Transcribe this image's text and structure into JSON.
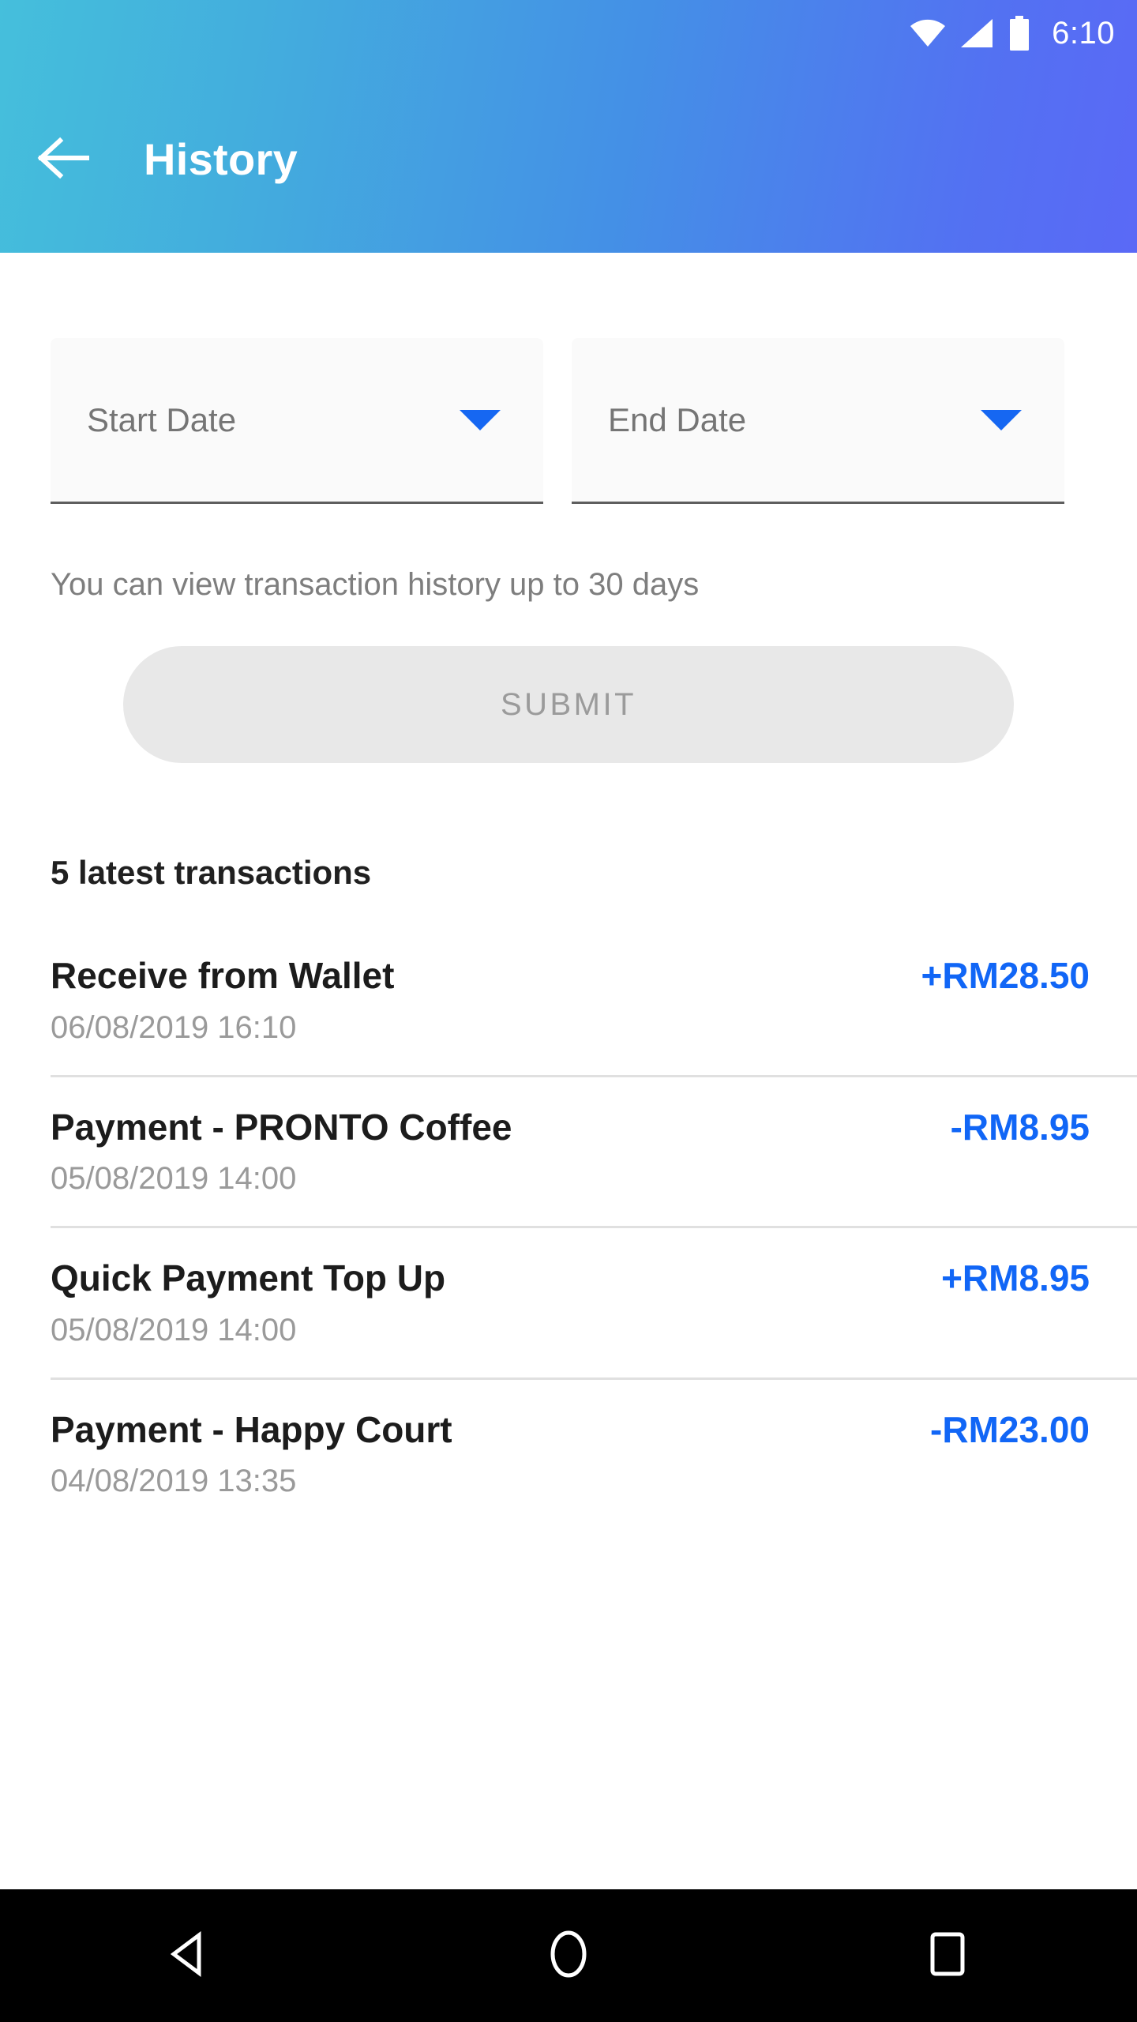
{
  "statusbar": {
    "time": "6:10",
    "icons": [
      "wifi-icon",
      "cellular-signal-icon",
      "battery-icon"
    ]
  },
  "appbar": {
    "title": "History",
    "back_icon": "arrow-left-icon"
  },
  "filters": {
    "start_date": {
      "label": "Start Date",
      "value": "",
      "caret_icon": "chevron-down-icon"
    },
    "end_date": {
      "label": "End Date",
      "value": "",
      "caret_icon": "chevron-down-icon"
    },
    "helper_text": "You can view transaction history up to 30 days",
    "submit_label": "SUBMIT"
  },
  "transactions": {
    "section_title": "5 latest transactions",
    "items": [
      {
        "name": "Receive from Wallet",
        "amount": "+RM28.50",
        "datetime": "06/08/2019 16:10"
      },
      {
        "name": "Payment - PRONTO Coffee",
        "amount": "-RM8.95",
        "datetime": "05/08/2019 14:00"
      },
      {
        "name": "Quick Payment Top Up",
        "amount": "+RM8.95",
        "datetime": "05/08/2019 14:00"
      },
      {
        "name": "Payment - Happy Court",
        "amount": "-RM23.00",
        "datetime": "04/08/2019 13:35"
      }
    ]
  },
  "navbar": {
    "back_icon": "triangle-back-icon",
    "home_icon": "circle-home-icon",
    "recents_icon": "square-recents-icon"
  },
  "colors": {
    "header_gradient_start": "#45BFDC",
    "header_gradient_end": "#5A69F6",
    "accent_blue": "#1166F6",
    "caret_blue": "#1667F2",
    "submit_bg": "#E8E8E8",
    "submit_text": "#9B9B9B",
    "muted_text": "#9A9A9A",
    "divider": "#E0E0E0"
  }
}
